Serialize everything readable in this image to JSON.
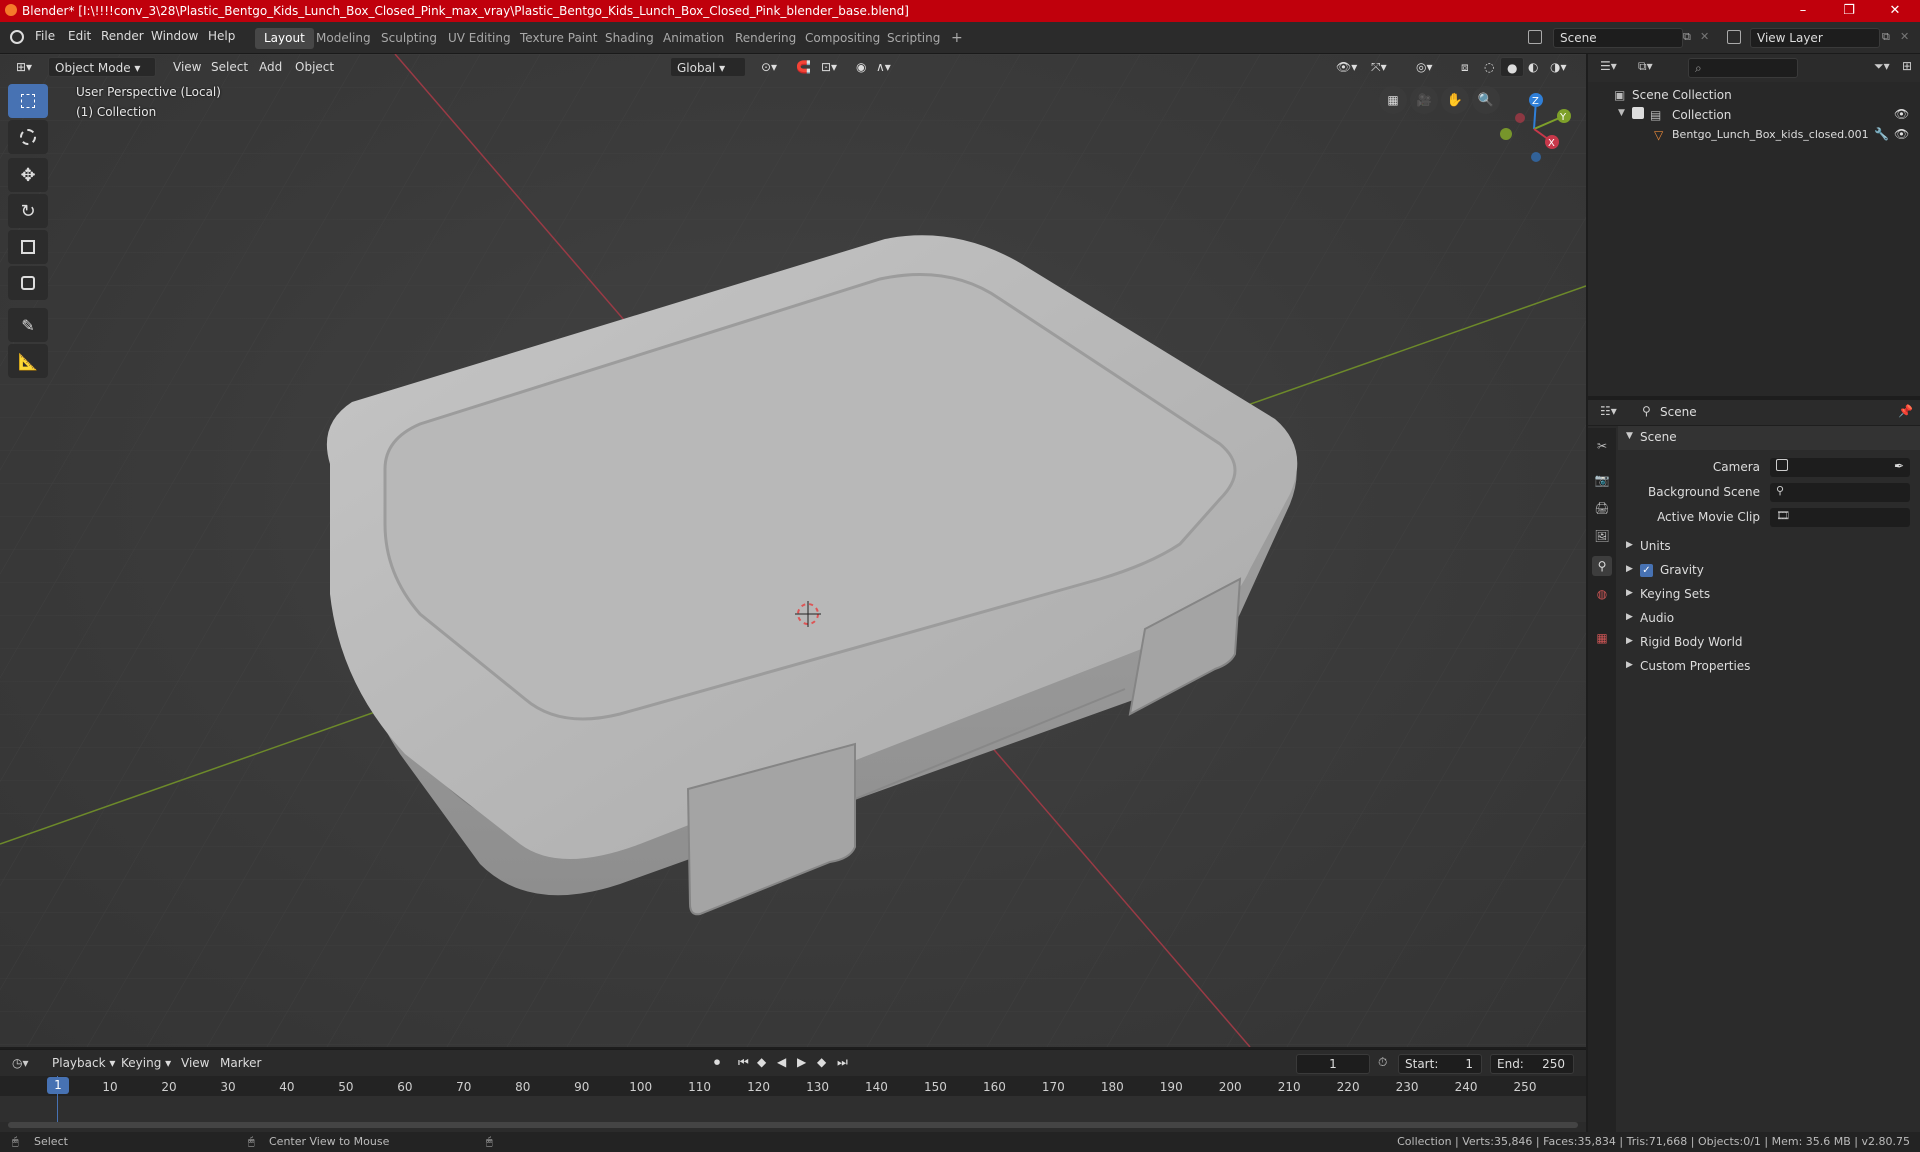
{
  "window": {
    "title": "Blender* [I:\\!!!!conv_3\\28\\Plastic_Bentgo_Kids_Lunch_Box_Closed_Pink_max_vray\\Plastic_Bentgo_Kids_Lunch_Box_Closed_Pink_blender_base.blend]",
    "minimize": "–",
    "maximize": "❐",
    "close": "✕"
  },
  "menus": [
    "File",
    "Edit",
    "Render",
    "Window",
    "Help"
  ],
  "workspaces": [
    "Layout",
    "Modeling",
    "Sculpting",
    "UV Editing",
    "Texture Paint",
    "Shading",
    "Animation",
    "Rendering",
    "Compositing",
    "Scripting"
  ],
  "workspace_add": "+",
  "scene_field": "Scene",
  "view_layer_field": "View Layer",
  "viewport_header": {
    "mode": "Object Mode",
    "menus": [
      "View",
      "Select",
      "Add",
      "Object"
    ],
    "orientation": "Global"
  },
  "viewport_overlay": {
    "line1": "User Perspective (Local)",
    "line2": "(1) Collection"
  },
  "gizmo": {
    "z": "Z",
    "y": "Y",
    "x": "X"
  },
  "outliner": {
    "root": "Scene Collection",
    "collection": "Collection",
    "object": "Bentgo_Lunch_Box_kids_closed.001"
  },
  "properties": {
    "header": "Scene",
    "panel": "Scene",
    "camera_label": "Camera",
    "background_scene_label": "Background Scene",
    "active_movie_clip_label": "Active Movie Clip",
    "subpanels": [
      "Units",
      "Gravity",
      "Keying Sets",
      "Audio",
      "Rigid Body World",
      "Custom Properties"
    ]
  },
  "timeline": {
    "menus": [
      "Playback",
      "Keying",
      "View",
      "Marker"
    ],
    "current_frame": "1",
    "start_label": "Start:",
    "start": "1",
    "end_label": "End:",
    "end": "250",
    "ticks": [
      "1",
      "10",
      "20",
      "30",
      "40",
      "50",
      "60",
      "70",
      "80",
      "90",
      "100",
      "110",
      "120",
      "130",
      "140",
      "150",
      "160",
      "170",
      "180",
      "190",
      "200",
      "210",
      "220",
      "230",
      "240",
      "250"
    ]
  },
  "statusbar": {
    "select": "Select",
    "center_view": "Center View to Mouse",
    "stats": "Collection | Verts:35,846 | Faces:35,834 | Tris:71,668 | Objects:0/1 | Mem: 35.6 MB | v2.80.75"
  },
  "colors": {
    "titlebar": "#c0000c",
    "accent": "#4772b3",
    "x_axis": "#c7384a",
    "y_axis": "#7ea02a",
    "z_axis": "#2f7fd8"
  }
}
